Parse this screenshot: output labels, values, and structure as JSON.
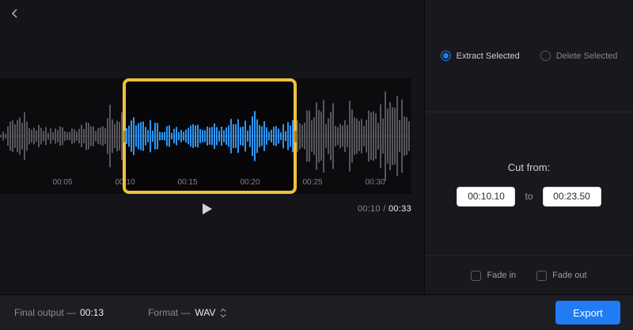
{
  "colors": {
    "accent_blue": "#1f7cf5",
    "selection_yellow": "#eec13d",
    "waveform_gray": "#56565c",
    "waveform_blue": "#2e96f7"
  },
  "icons": {
    "back": "chevron-left",
    "play": "play-triangle",
    "format_stepper": "up-down-chevrons"
  },
  "timeline": {
    "tick_labels": [
      "00:05",
      "00:10",
      "00:15",
      "00:20",
      "00:25",
      "00:30"
    ],
    "current_time": "00:10",
    "separator": "/",
    "duration": "00:33",
    "selection": {
      "start": "00:10.10",
      "end": "00:23.50"
    }
  },
  "panel": {
    "extract_label": "Extract Selected",
    "delete_label": "Delete Selected",
    "cut_from_label": "Cut from:",
    "cut_start_value": "00:10.10",
    "to_label": "to",
    "cut_end_value": "00:23.50",
    "fade_in_label": "Fade in",
    "fade_out_label": "Fade out"
  },
  "footer": {
    "final_output_label": "Final output —",
    "final_output_value": "00:13",
    "format_label": "Format —",
    "format_value": "WAV",
    "export_label": "Export"
  }
}
